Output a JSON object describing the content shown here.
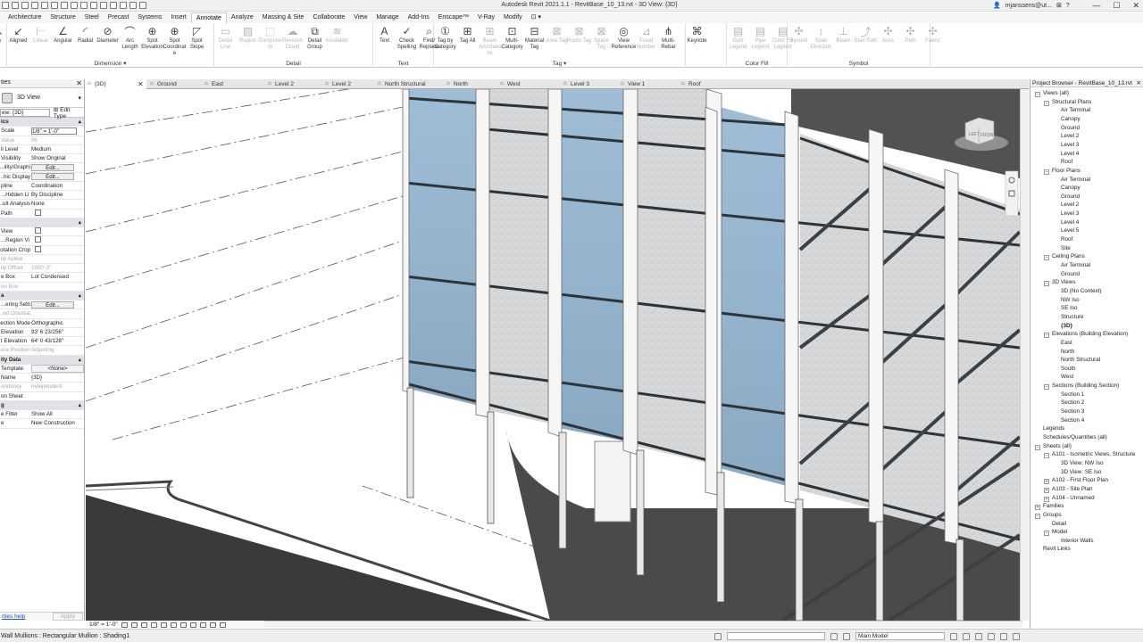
{
  "app_title": "Autodesk Revit 2021.1.1 - RevitBase_10_13.rvt - 3D View: {3D}",
  "user": "mjanssens@ut...",
  "tabs": [
    "Architecture",
    "Structure",
    "Steel",
    "Precast",
    "Systems",
    "Insert",
    "Annotate",
    "Analyze",
    "Massing & Site",
    "Collaborate",
    "View",
    "Manage",
    "Add-Ins",
    "Enscape™",
    "V-Ray",
    "Modify"
  ],
  "active_tab": "Annotate",
  "ribbon": {
    "groups": [
      {
        "name": "Dimension ▾",
        "tools": [
          {
            "label": "Aligned",
            "icon": "aligned-dimension-icon",
            "g": "↙"
          },
          {
            "label": "Linear",
            "icon": "linear-dimension-icon",
            "g": "⊢",
            "dim": true
          },
          {
            "label": "Angular",
            "icon": "angular-dimension-icon",
            "g": "∠"
          },
          {
            "label": "Radial",
            "icon": "radial-dimension-icon",
            "g": "◜"
          },
          {
            "label": "Diameter",
            "icon": "diameter-dimension-icon",
            "g": "⊘"
          },
          {
            "label": "Arc Length",
            "icon": "arc-length-icon",
            "g": "⌒"
          },
          {
            "label": "Spot Elevation",
            "icon": "spot-elevation-icon",
            "g": "⊕"
          },
          {
            "label": "Spot Coordinate",
            "icon": "spot-coordinate-icon",
            "g": "⊕"
          },
          {
            "label": "Spot Slope",
            "icon": "spot-slope-icon",
            "g": "◸"
          }
        ]
      },
      {
        "name": "Detail",
        "tools": [
          {
            "label": "Detail Line",
            "icon": "detail-line-icon",
            "g": "▭",
            "dim": true
          },
          {
            "label": "Region",
            "icon": "region-icon",
            "g": "▨",
            "dim": true
          },
          {
            "label": "Component",
            "icon": "component-icon",
            "g": "⬚",
            "dim": true
          },
          {
            "label": "Revision Cloud",
            "icon": "revision-cloud-icon",
            "g": "☁",
            "dim": true
          },
          {
            "label": "Detail Group",
            "icon": "detail-group-icon",
            "g": "⧉"
          },
          {
            "label": "Insulation",
            "icon": "insulation-icon",
            "g": "≋",
            "dim": true
          }
        ]
      },
      {
        "name": "Text",
        "tools": [
          {
            "label": "Text",
            "icon": "text-icon",
            "g": "A"
          },
          {
            "label": "Check Spelling",
            "icon": "check-spelling-icon",
            "g": "✓"
          },
          {
            "label": "Find/ Replace",
            "icon": "find-replace-icon",
            "g": "⌕"
          }
        ]
      },
      {
        "name": "Tag ▾",
        "tools": [
          {
            "label": "Tag by Category",
            "icon": "tag-by-category-icon",
            "g": "①"
          },
          {
            "label": "Tag All",
            "icon": "tag-all-icon",
            "g": "⊞"
          },
          {
            "label": "Beam Annotations",
            "icon": "beam-annotations-icon",
            "g": "⊞",
            "dim": true
          },
          {
            "label": "Multi- Category",
            "icon": "multi-category-icon",
            "g": "⊡"
          },
          {
            "label": "Material Tag",
            "icon": "material-tag-icon",
            "g": "⊟"
          },
          {
            "label": "Area Tag",
            "icon": "area-tag-icon",
            "g": "⊠",
            "dim": true
          },
          {
            "label": "Room Tag",
            "icon": "room-tag-icon",
            "g": "⊠",
            "dim": true
          },
          {
            "label": "Space Tag",
            "icon": "space-tag-icon",
            "g": "⊠",
            "dim": true
          },
          {
            "label": "View Reference",
            "icon": "view-reference-icon",
            "g": "◎"
          },
          {
            "label": "Tread Number",
            "icon": "tread-number-icon",
            "g": "⊿",
            "dim": true
          },
          {
            "label": "Multi- Rebar",
            "icon": "multi-rebar-icon",
            "g": "⋔"
          }
        ]
      },
      {
        "name": "",
        "tools": [
          {
            "label": "Keynote",
            "icon": "keynote-icon",
            "g": "⌘"
          }
        ]
      },
      {
        "name": "Color Fill",
        "tools": [
          {
            "label": "Duct Legend",
            "icon": "duct-legend-icon",
            "g": "▤",
            "dim": true
          },
          {
            "label": "Pipe Legend",
            "icon": "pipe-legend-icon",
            "g": "▤",
            "dim": true
          },
          {
            "label": "Color Fill Legend",
            "icon": "color-fill-legend-icon",
            "g": "▤",
            "dim": true
          }
        ]
      },
      {
        "name": "Symbol",
        "tools": [
          {
            "label": "Symbol",
            "icon": "symbol-icon",
            "g": "✣",
            "dim": true
          },
          {
            "label": "Span Direction",
            "icon": "span-direction-icon",
            "g": "↕",
            "dim": true
          },
          {
            "label": "Beam",
            "icon": "beam-symbol-icon",
            "g": "⊥",
            "dim": true
          },
          {
            "label": "Stair Path",
            "icon": "stair-path-icon",
            "g": "⤴",
            "dim": true
          },
          {
            "label": "Area",
            "icon": "area-symbol-icon",
            "g": "✣",
            "dim": true
          },
          {
            "label": "Path",
            "icon": "path-symbol-icon",
            "g": "✣",
            "dim": true
          },
          {
            "label": "Fabric",
            "icon": "fabric-symbol-icon",
            "g": "✣",
            "dim": true
          }
        ]
      }
    ]
  },
  "properties": {
    "header": "ties",
    "type_name": "3D View",
    "view_select": "ew: {3D}",
    "edit_type": "Edit Type",
    "rows": [
      {
        "k": "ics",
        "v": "",
        "type": "sec"
      },
      {
        "k": "Scale",
        "v": "1/8\" = 1'-0\"",
        "type": "input"
      },
      {
        "k": "Value",
        "v": "96",
        "type": "dis"
      },
      {
        "k": "il Level",
        "v": "Medium"
      },
      {
        "k": "Visibility",
        "v": "Show Original"
      },
      {
        "k": "ility/Graphi...",
        "v": "Edit...",
        "type": "btn"
      },
      {
        "k": "hic Display...",
        "v": "Edit...",
        "type": "btn"
      },
      {
        "k": "pline",
        "v": "Coordination"
      },
      {
        "k": "Hidden Li...",
        "v": "By Discipline"
      },
      {
        "k": "ult Analysis...",
        "v": "None"
      },
      {
        "k": "Path",
        "v": "",
        "type": "chk"
      },
      {
        "k": "",
        "v": "",
        "type": "sec"
      },
      {
        "k": "View",
        "v": "",
        "type": "chk"
      },
      {
        "k": "Region Vi...",
        "v": "",
        "type": "chk"
      },
      {
        "k": "otation Crop",
        "v": "",
        "type": "chk"
      },
      {
        "k": "lip Active",
        "v": "",
        "type": "dis"
      },
      {
        "k": "lip Offset",
        "v": "1000'  0\"",
        "type": "dis"
      },
      {
        "k": "e Box",
        "v": "Lot Condensed"
      },
      {
        "k": "on Box",
        "v": "",
        "type": "dis"
      },
      {
        "k": "a",
        "v": "",
        "type": "sec"
      },
      {
        "k": "ering Setti...",
        "v": "Edit...",
        "type": "btn"
      },
      {
        "k": "ed Orientat...",
        "v": "",
        "type": "dis"
      },
      {
        "k": "ection Mode",
        "v": "Orthographic"
      },
      {
        "k": "Elevation",
        "v": "93'  6 23/256\""
      },
      {
        "k": "t Elevation",
        "v": "64'  0 43/128\""
      },
      {
        "k": "era Position",
        "v": "Adjusting",
        "type": "dis"
      },
      {
        "k": "ity Data",
        "v": "",
        "type": "sec"
      },
      {
        "k": "Template",
        "v": "<None>",
        "type": "center"
      },
      {
        "k": "Name",
        "v": "{3D}"
      },
      {
        "k": "endency",
        "v": "Independent",
        "type": "dis"
      },
      {
        "k": "on Sheet",
        "v": ""
      },
      {
        "k": "g",
        "v": "",
        "type": "sec"
      },
      {
        "k": "e Filter",
        "v": "Show All"
      },
      {
        "k": "e",
        "v": "New Construction"
      }
    ],
    "help_link": "rties help",
    "apply": "Apply"
  },
  "view_tabs": [
    "{3D}",
    "Ground",
    "East",
    "Level 2",
    "Level 2",
    "North Structural",
    "North",
    "West",
    "Level 3",
    "View 1",
    "Roof"
  ],
  "view_control_scale": "1/8\" = 1'-0\"",
  "project_browser": {
    "title": "Project Browser - RevitBase_10_13.rvt",
    "nodes": [
      {
        "t": "Views (all)",
        "lvl": 0,
        "tg": "−"
      },
      {
        "t": "Structural Plans",
        "lvl": 1,
        "tg": "−"
      },
      {
        "t": "Air Terminal",
        "lvl": 2
      },
      {
        "t": "Canopy",
        "lvl": 2
      },
      {
        "t": "Ground",
        "lvl": 2
      },
      {
        "t": "Level 2",
        "lvl": 2
      },
      {
        "t": "Level 3",
        "lvl": 2
      },
      {
        "t": "Level 4",
        "lvl": 2
      },
      {
        "t": "Roof",
        "lvl": 2
      },
      {
        "t": "Floor Plans",
        "lvl": 1,
        "tg": "−"
      },
      {
        "t": "Air Terminal",
        "lvl": 2
      },
      {
        "t": "Canopy",
        "lvl": 2
      },
      {
        "t": "Ground",
        "lvl": 2
      },
      {
        "t": "Level 2",
        "lvl": 2
      },
      {
        "t": "Level 3",
        "lvl": 2
      },
      {
        "t": "Level 4",
        "lvl": 2
      },
      {
        "t": "Level 5",
        "lvl": 2
      },
      {
        "t": "Roof",
        "lvl": 2
      },
      {
        "t": "Site",
        "lvl": 2
      },
      {
        "t": "Ceiling Plans",
        "lvl": 1,
        "tg": "−"
      },
      {
        "t": "Air Terminal",
        "lvl": 2
      },
      {
        "t": "Ground",
        "lvl": 2
      },
      {
        "t": "3D Views",
        "lvl": 1,
        "tg": "−"
      },
      {
        "t": "3D (No Context)",
        "lvl": 2
      },
      {
        "t": "NW Iso",
        "lvl": 2
      },
      {
        "t": "SE Iso",
        "lvl": 2
      },
      {
        "t": "Structure",
        "lvl": 2
      },
      {
        "t": "{3D}",
        "lvl": 2,
        "bold": true
      },
      {
        "t": "Elevations (Building Elevation)",
        "lvl": 1,
        "tg": "−"
      },
      {
        "t": "East",
        "lvl": 2
      },
      {
        "t": "North",
        "lvl": 2
      },
      {
        "t": "North Structural",
        "lvl": 2
      },
      {
        "t": "South",
        "lvl": 2
      },
      {
        "t": "West",
        "lvl": 2
      },
      {
        "t": "Sections (Building Section)",
        "lvl": 1,
        "tg": "−"
      },
      {
        "t": "Section 1",
        "lvl": 2
      },
      {
        "t": "Section 2",
        "lvl": 2
      },
      {
        "t": "Section 3",
        "lvl": 2
      },
      {
        "t": "Section 4",
        "lvl": 2
      },
      {
        "t": "Legends",
        "lvl": 0
      },
      {
        "t": "Schedules/Quantities (all)",
        "lvl": 0
      },
      {
        "t": "Sheets (all)",
        "lvl": 0,
        "tg": "−"
      },
      {
        "t": "A101 - Isometric Views, Structure",
        "lvl": 1,
        "tg": "−"
      },
      {
        "t": "3D View: NW Iso",
        "lvl": 2
      },
      {
        "t": "3D View: SE Iso",
        "lvl": 2
      },
      {
        "t": "A102 - First Floor Plan",
        "lvl": 1,
        "tg": "+"
      },
      {
        "t": "A103 - Site Plan",
        "lvl": 1,
        "tg": "+"
      },
      {
        "t": "A104 - Unnamed",
        "lvl": 1,
        "tg": "+"
      },
      {
        "t": "Families",
        "lvl": 0,
        "tg": "+"
      },
      {
        "t": "Groups",
        "lvl": 0,
        "tg": "−"
      },
      {
        "t": "Detail",
        "lvl": 1
      },
      {
        "t": "Model",
        "lvl": 1,
        "tg": "−"
      },
      {
        "t": "Interior Walls",
        "lvl": 2
      },
      {
        "t": "Revit Links",
        "lvl": 0
      }
    ]
  },
  "viewcube": {
    "left": "LEFT",
    "front": "FRONT"
  },
  "status": {
    "message": "Wall Mullions : Rectangular Mullion : Shading1",
    "model": "Main Model"
  }
}
